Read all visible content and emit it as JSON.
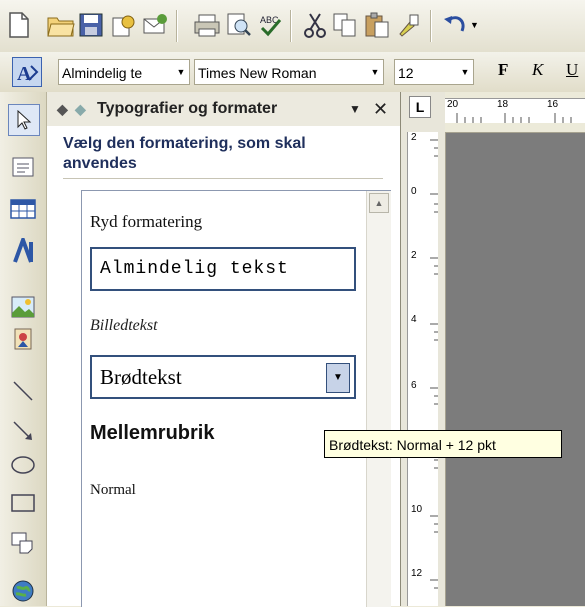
{
  "toolbar": {
    "style_value": "Almindelig te",
    "font_value": "Times New Roman",
    "size_value": "12",
    "bold_label": "F",
    "italic_label": "K",
    "underline_label": "U"
  },
  "task_pane": {
    "title": "Typografier og formater",
    "subtitle": "Vælg den formatering, som skal anvendes",
    "items": [
      {
        "label": "Ryd formatering"
      },
      {
        "label": "Almindelig tekst"
      },
      {
        "label": "Billedtekst"
      },
      {
        "label": "Brødtekst"
      },
      {
        "label": "Mellemrubrik"
      },
      {
        "label": "Normal"
      }
    ]
  },
  "ruler": {
    "horizontal_ticks": [
      "20",
      "18",
      "16"
    ],
    "vertical_ticks": [
      "2",
      "0",
      "2",
      "4",
      "6",
      "10",
      "12"
    ]
  },
  "tooltip": {
    "text": "Brødtekst: Normal + 12 pkt"
  },
  "icons": [
    "new-document-icon",
    "open-folder-icon",
    "save-icon",
    "permission-icon",
    "email-icon",
    "print-icon",
    "print-preview-icon",
    "spelling-icon",
    "cut-icon",
    "copy-icon",
    "paste-icon",
    "format-painter-icon",
    "undo-icon",
    "styles-formatting-icon",
    "select-objects-icon",
    "textbox-icon",
    "table-icon",
    "wordart-icon",
    "picture-icon",
    "clipart-icon",
    "line-icon",
    "arrow-icon",
    "oval-icon",
    "rectangle-icon",
    "autoshape-icon",
    "globe-icon"
  ]
}
